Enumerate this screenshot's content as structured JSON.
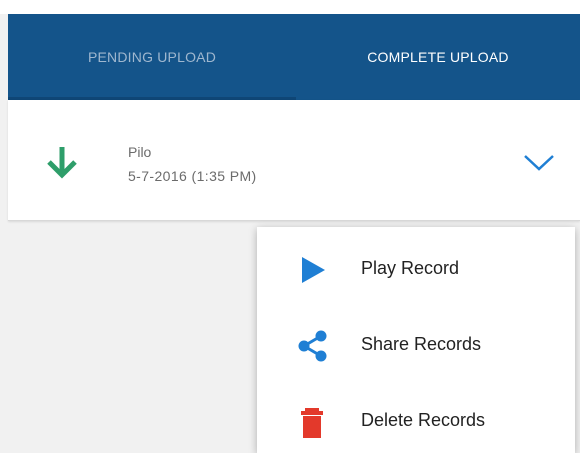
{
  "tabs": {
    "pending_label": "PENDING UPLOAD",
    "complete_label": "COMPLETE UPLOAD",
    "active": "complete"
  },
  "record": {
    "name": "Pilo",
    "date": "5-7-2016 (1:35 PM)",
    "status_icon": "download-arrow-icon",
    "expand_icon": "chevron-down-icon"
  },
  "menu": {
    "items": [
      {
        "label": "Play Record",
        "icon": "play-icon"
      },
      {
        "label": "Share Records",
        "icon": "share-icon"
      },
      {
        "label": "Delete Records",
        "icon": "trash-icon"
      }
    ]
  },
  "colors": {
    "header": "#14548a",
    "download_icon": "#2e9e6a",
    "chevron": "#1f7fd4",
    "play_icon": "#1f7fd4",
    "share_icon": "#1f7fd4",
    "trash_icon": "#e3392b"
  }
}
